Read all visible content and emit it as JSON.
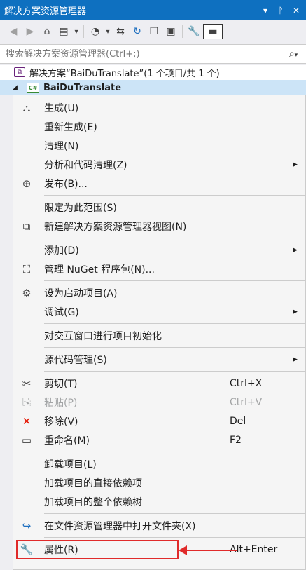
{
  "window": {
    "title": "解决方案资源管理器",
    "title_icons": [
      "▾",
      "ᚹ",
      "✕"
    ]
  },
  "toolbar": {
    "back_icon": "◀",
    "forward_icon": "▶",
    "home_icon": "⌂",
    "switch_views_icon": "▤",
    "dropdown_icon": "▾",
    "pending_changes_icon": "◔",
    "sync_icon": "⇆",
    "refresh_icon": "↻",
    "collapse_icon": "❐",
    "show_all_icon": "▣",
    "properties_icon": "🔧",
    "preview_icon": "▬"
  },
  "search": {
    "placeholder": "搜索解决方案资源管理器(Ctrl+;)",
    "icon": "⌕",
    "dropdown_icon": "▾"
  },
  "tree": {
    "solution_label": "解决方案“BaiDuTranslate”(1 个项目/共 1 个)",
    "project_label": "BaiDuTranslate",
    "project_badge": "C#",
    "solution_badge": "⧉",
    "expand_icon": "◢"
  },
  "menu": {
    "groups": [
      [
        {
          "icon": "⛬",
          "label": "生成(U)",
          "shortcut": "",
          "submenu": false
        },
        {
          "icon": "",
          "label": "重新生成(E)",
          "shortcut": "",
          "submenu": false
        },
        {
          "icon": "",
          "label": "清理(N)",
          "shortcut": "",
          "submenu": false
        },
        {
          "icon": "",
          "label": "分析和代码清理(Z)",
          "shortcut": "",
          "submenu": true
        },
        {
          "icon": "⊕",
          "label": "发布(B)...",
          "shortcut": "",
          "submenu": false
        }
      ],
      [
        {
          "icon": "",
          "label": "限定为此范围(S)",
          "shortcut": "",
          "submenu": false
        },
        {
          "icon": "⧉",
          "label": "新建解决方案资源管理器视图(N)",
          "shortcut": "",
          "submenu": false
        }
      ],
      [
        {
          "icon": "",
          "label": "添加(D)",
          "shortcut": "",
          "submenu": true
        },
        {
          "icon": "⛶",
          "label": "管理 NuGet 程序包(N)...",
          "shortcut": "",
          "submenu": false
        }
      ],
      [
        {
          "icon": "⚙",
          "label": "设为启动项目(A)",
          "shortcut": "",
          "submenu": false
        },
        {
          "icon": "",
          "label": "调试(G)",
          "shortcut": "",
          "submenu": true
        }
      ],
      [
        {
          "icon": "",
          "label": "对交互窗口进行项目初始化",
          "shortcut": "",
          "submenu": false
        }
      ],
      [
        {
          "icon": "",
          "label": "源代码管理(S)",
          "shortcut": "",
          "submenu": true
        }
      ],
      [
        {
          "icon": "✂",
          "label": "剪切(T)",
          "shortcut": "Ctrl+X",
          "submenu": false
        },
        {
          "icon": "⎘",
          "label": "粘贴(P)",
          "shortcut": "Ctrl+V",
          "submenu": false,
          "disabled": true
        },
        {
          "icon": "✕",
          "label": "移除(V)",
          "shortcut": "Del",
          "submenu": false,
          "color": "#e51400"
        },
        {
          "icon": "▭",
          "label": "重命名(M)",
          "shortcut": "F2",
          "submenu": false
        }
      ],
      [
        {
          "icon": "",
          "label": "卸载项目(L)",
          "shortcut": "",
          "submenu": false
        },
        {
          "icon": "",
          "label": "加载项目的直接依赖项",
          "shortcut": "",
          "submenu": false
        },
        {
          "icon": "",
          "label": "加载项目的整个依赖树",
          "shortcut": "",
          "submenu": false
        }
      ],
      [
        {
          "icon": "↪",
          "label": "在文件资源管理器中打开文件夹(X)",
          "shortcut": "",
          "submenu": false,
          "color": "#1e6fbf"
        }
      ],
      [
        {
          "icon": "🔧",
          "label": "属性(R)",
          "shortcut": "Alt+Enter",
          "submenu": false,
          "highlighted": true
        }
      ]
    ],
    "submenu_arrow": "▶",
    "highlight_color": "#e02a2a"
  }
}
